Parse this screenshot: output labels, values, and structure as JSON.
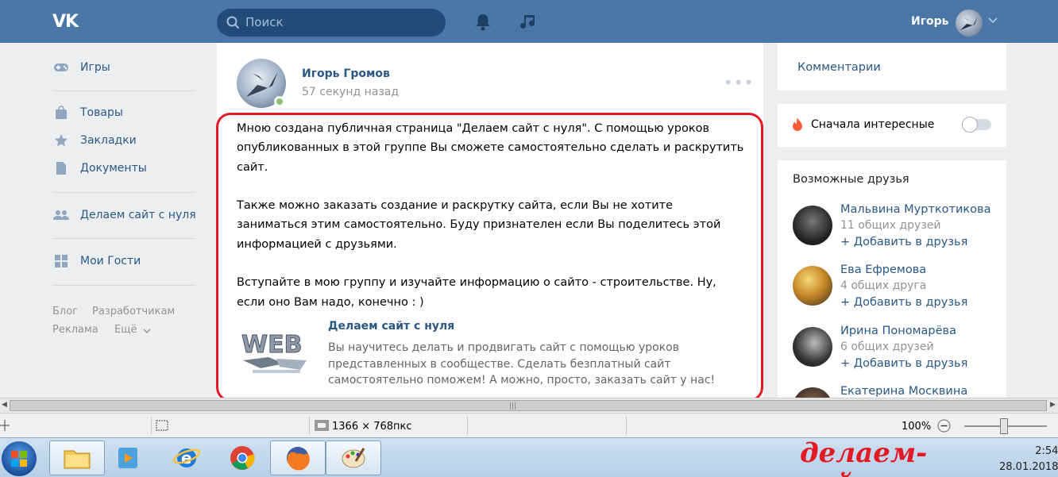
{
  "header": {
    "logo": "VK",
    "search_placeholder": "Поиск",
    "user_name": "Игорь"
  },
  "sidebar": {
    "items": [
      {
        "label": "Игры",
        "icon": "gamepad-icon"
      },
      {
        "label": "Товары",
        "icon": "bag-icon"
      },
      {
        "label": "Закладки",
        "icon": "star-icon"
      },
      {
        "label": "Документы",
        "icon": "document-icon"
      },
      {
        "label": "Делаем сайт с нуля",
        "icon": "group-icon"
      },
      {
        "label": "Мои Гости",
        "icon": "apps-icon"
      }
    ],
    "footer": {
      "blog": "Блог",
      "developers": "Разработчикам",
      "ads": "Реклама",
      "more": "Ещё"
    }
  },
  "post": {
    "author": "Игорь Громов",
    "time": "57 секунд назад",
    "paragraphs": [
      "Мною создана публичная страница \"Делаем сайт с нуля\". С помощью уроков опубликованных в этой группе Вы сможете самостоятельно сделать и раскрутить сайт.",
      "Также можно заказать создание и раскрутку сайта, если Вы не хотите заниматься этим самостоятельно. Буду признателен если Вы поделитесь этой информацией с друзьями.",
      "Вступайте в мою группу и изучайте информацию о сайто - строительстве. Ну, если оно Вам надо, конечно : )"
    ],
    "link": {
      "title": "Делаем сайт с нуля",
      "description": "Вы научитесь делать и продвигать сайт с помощью уроков представленных в сообществе. Сделать безплатный сайт самостоятельно поможем! А можно, просто, заказать сайт у нас!",
      "thumb_text": "WEB"
    }
  },
  "right": {
    "comments_label": "Комментарии",
    "filter_label": "Сначала интересные",
    "friends_title": "Возможные друзья",
    "add_label": "Добавить в друзья",
    "friends": [
      {
        "name": "Мальвина Мурткотикова",
        "mutual": "11 общих друзей"
      },
      {
        "name": "Ева Ефремова",
        "mutual": "4 общих друга"
      },
      {
        "name": "Ирина Пономарёва",
        "mutual": "6 общих друзей"
      },
      {
        "name": "Екатерина Москвина",
        "mutual": ""
      }
    ]
  },
  "statusbar": {
    "dimensions": "1366 × 768пкс",
    "zoom": "100%"
  },
  "taskbar": {
    "watermark": "делаем-сайт.com",
    "time": "2:54",
    "date": "28.01.2018"
  }
}
